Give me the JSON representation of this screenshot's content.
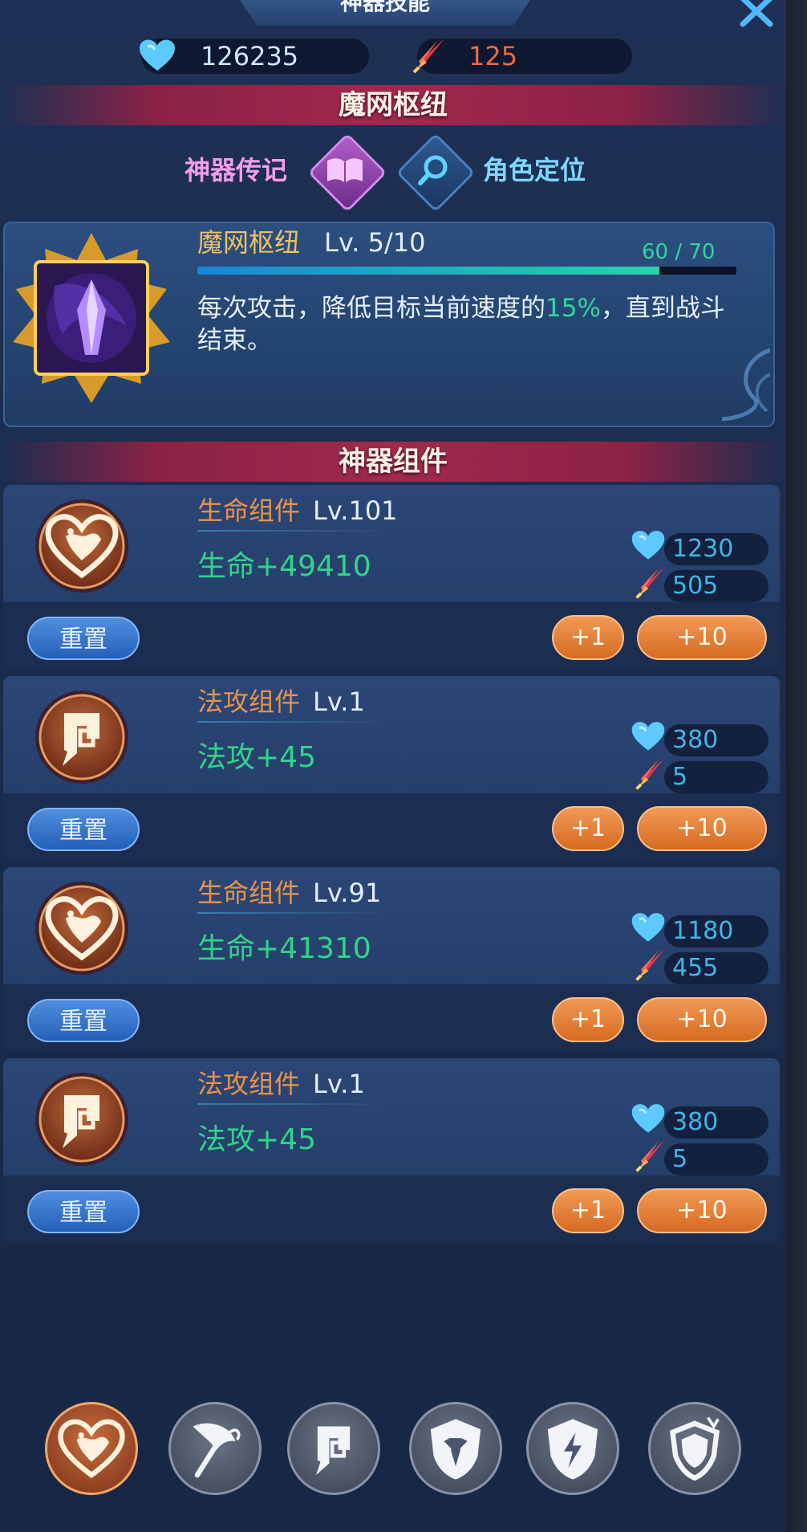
{
  "header": {
    "title": "神器技能"
  },
  "currency": {
    "hearts": "126235",
    "swords": "125"
  },
  "ribbon_top": "魔网枢纽",
  "tabs": [
    {
      "label": "神器传记",
      "icon": "book-icon"
    },
    {
      "label": "角色定位",
      "icon": "magnifier-icon"
    }
  ],
  "skill": {
    "name": "魔网枢纽",
    "level": "Lv. 5/10",
    "xp": "60 / 70",
    "xp_progress": 0.857,
    "desc_before": "每次攻击，降低目标当前速度的",
    "desc_highlight": "15%",
    "desc_after": "，直到战斗结束。"
  },
  "ribbon_components": "神器组件",
  "components": [
    {
      "icon": "heart-icon",
      "name": "生命组件",
      "level": "Lv.101",
      "stat": "生命+49410",
      "cost_hearts": "1230",
      "cost_swords": "505",
      "reset": "重置",
      "plus1": "+1",
      "plus10": "+10"
    },
    {
      "icon": "magic-attack-icon",
      "name": "法攻组件",
      "level": "Lv.1",
      "stat": "法攻+45",
      "cost_hearts": "380",
      "cost_swords": "5",
      "reset": "重置",
      "plus1": "+1",
      "plus10": "+10"
    },
    {
      "icon": "heart-icon",
      "name": "生命组件",
      "level": "Lv.91",
      "stat": "生命+41310",
      "cost_hearts": "1180",
      "cost_swords": "455",
      "reset": "重置",
      "plus1": "+1",
      "plus10": "+10"
    },
    {
      "icon": "magic-attack-icon",
      "name": "法攻组件",
      "level": "Lv.1",
      "stat": "法攻+45",
      "cost_hearts": "380",
      "cost_swords": "5",
      "reset": "重置",
      "plus1": "+1",
      "plus10": "+10"
    }
  ],
  "bottom_nav": [
    {
      "icon": "heart-icon",
      "active": true
    },
    {
      "icon": "axe-icon",
      "active": false
    },
    {
      "icon": "magic-attack-icon",
      "active": false
    },
    {
      "icon": "physical-defense-icon",
      "active": false
    },
    {
      "icon": "lightning-shield-icon",
      "active": false
    },
    {
      "icon": "resistance-shield-icon",
      "active": false
    }
  ],
  "colors": {
    "accent_orange": "#e8934a",
    "stat_green": "#30d48a",
    "cost_blue": "#3fb6e8",
    "ribbon_red": "#a02a4e"
  }
}
